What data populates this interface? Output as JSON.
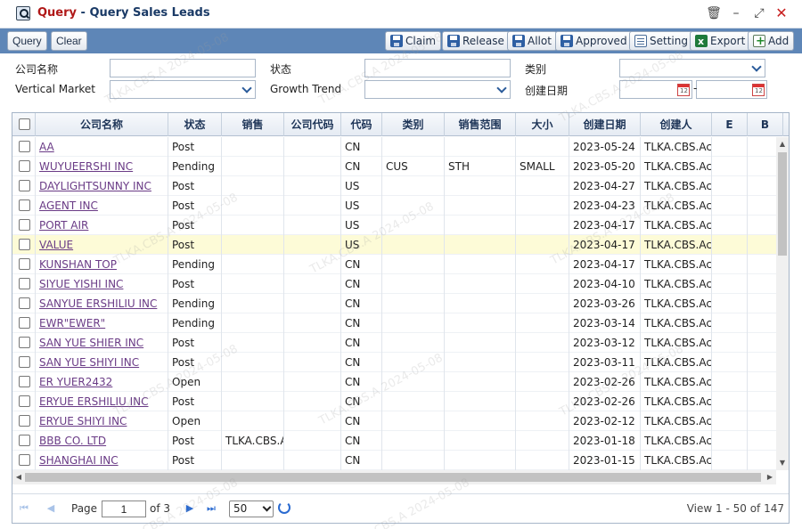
{
  "window": {
    "title_prefix": "Query",
    "title_sep": " - ",
    "title_main": "Query Sales Leads",
    "controls": [
      "delete",
      "minimize",
      "maximize",
      "close"
    ]
  },
  "toolbar": {
    "query_label": "Query",
    "clear_label": "Clear",
    "claim_label": "Claim",
    "release_label": "Release",
    "allot_label": "Allot",
    "approved_label": "Approved",
    "setting_label": "Setting",
    "export_label": "Export",
    "add_label": "Add"
  },
  "form": {
    "company_name_label": "公司名称",
    "company_name_value": "",
    "status_label": "状态",
    "status_value": "",
    "category_label": "类别",
    "category_value": "",
    "vertical_market_label": "Vertical Market",
    "vertical_market_value": "",
    "growth_trend_label": "Growth Trend",
    "growth_trend_value": "",
    "created_date_label": "创建日期",
    "created_date_from": "",
    "created_date_to": "",
    "date_sep": "-"
  },
  "grid": {
    "columns": {
      "company": "公司名称",
      "status": "状态",
      "sales": "销售",
      "company_code": "公司代码",
      "code": "代码",
      "category": "类别",
      "sales_range": "销售范围",
      "size": "大小",
      "created_date": "创建日期",
      "creator": "创建人",
      "e": "E",
      "b": "B"
    },
    "rows": [
      {
        "company": "AA",
        "status": "Post",
        "sales": "",
        "company_code": "",
        "code": "CN",
        "category": "",
        "sales_range": "",
        "size": "",
        "created_date": "2023-05-24",
        "creator": "TLKA.CBS.Ac"
      },
      {
        "company": "WUYUEERSHI INC",
        "status": "Pending",
        "sales": "",
        "company_code": "",
        "code": "CN",
        "category": "CUS",
        "sales_range": "STH",
        "size": "SMALL",
        "created_date": "2023-05-20",
        "creator": "TLKA.CBS.Ac"
      },
      {
        "company": "DAYLIGHTSUNNY INC",
        "status": "Post",
        "sales": "",
        "company_code": "",
        "code": "US",
        "category": "",
        "sales_range": "",
        "size": "",
        "created_date": "2023-04-27",
        "creator": "TLKA.CBS.Ac"
      },
      {
        "company": "AGENT INC",
        "status": "Post",
        "sales": "",
        "company_code": "",
        "code": "US",
        "category": "",
        "sales_range": "",
        "size": "",
        "created_date": "2023-04-23",
        "creator": "TLKA.CBS.Ac"
      },
      {
        "company": "PORT AIR",
        "status": "Post",
        "sales": "",
        "company_code": "",
        "code": "US",
        "category": "",
        "sales_range": "",
        "size": "",
        "created_date": "2023-04-17",
        "creator": "TLKA.CBS.Ac"
      },
      {
        "company": "VALUE",
        "status": "Post",
        "sales": "",
        "company_code": "",
        "code": "US",
        "category": "",
        "sales_range": "",
        "size": "",
        "created_date": "2023-04-17",
        "creator": "TLKA.CBS.Ac"
      },
      {
        "company": "KUNSHAN TOP",
        "status": "Pending",
        "sales": "",
        "company_code": "",
        "code": "CN",
        "category": "",
        "sales_range": "",
        "size": "",
        "created_date": "2023-04-17",
        "creator": "TLKA.CBS.Ac"
      },
      {
        "company": "SIYUE YISHI INC",
        "status": "Post",
        "sales": "",
        "company_code": "",
        "code": "CN",
        "category": "",
        "sales_range": "",
        "size": "",
        "created_date": "2023-04-10",
        "creator": "TLKA.CBS.Ac"
      },
      {
        "company": "SANYUE ERSHILIU INC",
        "status": "Pending",
        "sales": "",
        "company_code": "",
        "code": "CN",
        "category": "",
        "sales_range": "",
        "size": "",
        "created_date": "2023-03-26",
        "creator": "TLKA.CBS.Ac"
      },
      {
        "company": "EWR\"EWER\"",
        "status": "Pending",
        "sales": "",
        "company_code": "",
        "code": "CN",
        "category": "",
        "sales_range": "",
        "size": "",
        "created_date": "2023-03-14",
        "creator": "TLKA.CBS.Ac"
      },
      {
        "company": "SAN YUE SHIER INC",
        "status": "Post",
        "sales": "",
        "company_code": "",
        "code": "CN",
        "category": "",
        "sales_range": "",
        "size": "",
        "created_date": "2023-03-12",
        "creator": "TLKA.CBS.Ac"
      },
      {
        "company": "SAN YUE SHIYI INC",
        "status": "Post",
        "sales": "",
        "company_code": "",
        "code": "CN",
        "category": "",
        "sales_range": "",
        "size": "",
        "created_date": "2023-03-11",
        "creator": "TLKA.CBS.Ac"
      },
      {
        "company": "ER YUER2432",
        "status": "Open",
        "sales": "",
        "company_code": "",
        "code": "CN",
        "category": "",
        "sales_range": "",
        "size": "",
        "created_date": "2023-02-26",
        "creator": "TLKA.CBS.Ac"
      },
      {
        "company": "ERYUE ERSHILIU INC",
        "status": "Post",
        "sales": "",
        "company_code": "",
        "code": "CN",
        "category": "",
        "sales_range": "",
        "size": "",
        "created_date": "2023-02-26",
        "creator": "TLKA.CBS.Ac"
      },
      {
        "company": "ERYUE SHIYI INC",
        "status": "Open",
        "sales": "",
        "company_code": "",
        "code": "CN",
        "category": "",
        "sales_range": "",
        "size": "",
        "created_date": "2023-02-12",
        "creator": "TLKA.CBS.Ac"
      },
      {
        "company": "BBB CO. LTD",
        "status": "Post",
        "sales": "TLKA.CBS.A",
        "company_code": "",
        "code": "CN",
        "category": "",
        "sales_range": "",
        "size": "",
        "created_date": "2023-01-18",
        "creator": "TLKA.CBS.Ac"
      },
      {
        "company": "SHANGHAI INC",
        "status": "Post",
        "sales": "",
        "company_code": "",
        "code": "CN",
        "category": "",
        "sales_range": "",
        "size": "",
        "created_date": "2023-01-15",
        "creator": "TLKA.CBS.Ac"
      }
    ],
    "highlight_row_index": 5
  },
  "pager": {
    "page_label": "Page",
    "page_value": "1",
    "of_label": "of 3",
    "page_size": "50",
    "view_info": "View 1 - 50 of 147"
  },
  "watermark": "TLKA.CBS.A 2024-05-08",
  "colors": {
    "toolbar_bg": "#5e86b7",
    "title_accent": "#b01818",
    "title_main": "#1a3a66",
    "link": "#6a3b86",
    "highlight_row": "#fdfbd7"
  }
}
